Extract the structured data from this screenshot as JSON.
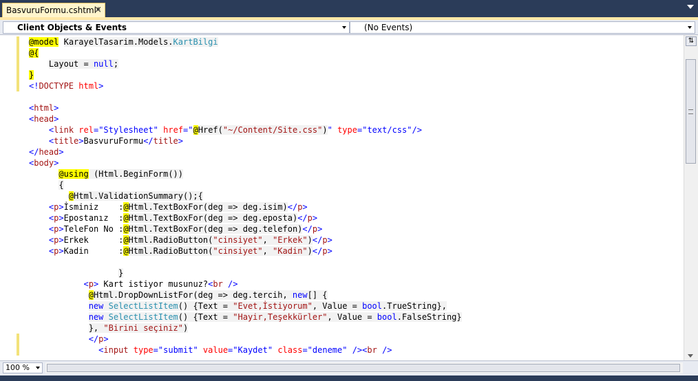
{
  "tab": {
    "title": "BasvuruFormu.cshtml*",
    "close": "×"
  },
  "nav": {
    "objects": "Client Objects & Events",
    "events": "(No Events)"
  },
  "zoom": "100 %",
  "code_lines": [
    [
      {
        "t": "@model",
        "c": "razor"
      },
      {
        "t": " "
      },
      {
        "t": "KarayelTasarim.Models.",
        "c": "strip"
      },
      {
        "t": "KartBilgi",
        "c": "k-type strip"
      }
    ],
    [
      {
        "t": "@{",
        "c": "razor"
      }
    ],
    [
      {
        "t": "    "
      },
      {
        "t": "Layout = ",
        "c": "strip"
      },
      {
        "t": "null",
        "c": "k-blue strip"
      },
      {
        "t": ";",
        "c": "strip"
      }
    ],
    [
      {
        "t": "}",
        "c": "razor"
      }
    ],
    [
      {
        "t": "<!",
        "c": "k-blue"
      },
      {
        "t": "DOCTYPE",
        "c": "k-maroon"
      },
      {
        "t": " "
      },
      {
        "t": "html",
        "c": "k-red"
      },
      {
        "t": ">",
        "c": "k-blue"
      }
    ],
    [
      {
        "t": ""
      }
    ],
    [
      {
        "t": "<",
        "c": "k-blue"
      },
      {
        "t": "html",
        "c": "k-maroon"
      },
      {
        "t": ">",
        "c": "k-blue"
      }
    ],
    [
      {
        "t": "<",
        "c": "k-blue"
      },
      {
        "t": "head",
        "c": "k-maroon"
      },
      {
        "t": ">",
        "c": "k-blue"
      }
    ],
    [
      {
        "t": "    "
      },
      {
        "t": "<",
        "c": "k-blue"
      },
      {
        "t": "link",
        "c": "k-maroon"
      },
      {
        "t": " "
      },
      {
        "t": "rel",
        "c": "k-red"
      },
      {
        "t": "=",
        "c": "k-blue"
      },
      {
        "t": "\"Stylesheet\"",
        "c": "k-blue"
      },
      {
        "t": " "
      },
      {
        "t": "href",
        "c": "k-red"
      },
      {
        "t": "=",
        "c": "k-blue"
      },
      {
        "t": "\"",
        "c": "k-blue"
      },
      {
        "t": "@",
        "c": "razor"
      },
      {
        "t": "Href(",
        "c": "strip"
      },
      {
        "t": "\"~/Content/Site.css\"",
        "c": "k-str strip"
      },
      {
        "t": ")",
        "c": "strip"
      },
      {
        "t": "\"",
        "c": "k-blue"
      },
      {
        "t": " "
      },
      {
        "t": "type",
        "c": "k-red"
      },
      {
        "t": "=",
        "c": "k-blue"
      },
      {
        "t": "\"text/css\"",
        "c": "k-blue"
      },
      {
        "t": "/>",
        "c": "k-blue"
      }
    ],
    [
      {
        "t": "    "
      },
      {
        "t": "<",
        "c": "k-blue"
      },
      {
        "t": "title",
        "c": "k-maroon"
      },
      {
        "t": ">",
        "c": "k-blue"
      },
      {
        "t": "BasvuruFormu"
      },
      {
        "t": "</",
        "c": "k-blue"
      },
      {
        "t": "title",
        "c": "k-maroon"
      },
      {
        "t": ">",
        "c": "k-blue"
      }
    ],
    [
      {
        "t": "</",
        "c": "k-blue"
      },
      {
        "t": "head",
        "c": "k-maroon"
      },
      {
        "t": ">",
        "c": "k-blue"
      }
    ],
    [
      {
        "t": "<",
        "c": "k-blue"
      },
      {
        "t": "body",
        "c": "k-maroon"
      },
      {
        "t": ">",
        "c": "k-blue"
      }
    ],
    [
      {
        "t": "      "
      },
      {
        "t": "@using",
        "c": "razor"
      },
      {
        "t": " (Html.BeginForm())",
        "c": "strip"
      }
    ],
    [
      {
        "t": "      "
      },
      {
        "t": "{",
        "c": "strip"
      }
    ],
    [
      {
        "t": "        "
      },
      {
        "t": "@",
        "c": "razor"
      },
      {
        "t": "Html.ValidationSummary();{",
        "c": "strip"
      }
    ],
    [
      {
        "t": "    "
      },
      {
        "t": "<",
        "c": "k-blue"
      },
      {
        "t": "p",
        "c": "k-maroon"
      },
      {
        "t": ">",
        "c": "k-blue"
      },
      {
        "t": "İsminiz    :"
      },
      {
        "t": "@",
        "c": "razor"
      },
      {
        "t": "Html.TextBoxFor(deg => deg.isim)",
        "c": "strip"
      },
      {
        "t": "</",
        "c": "k-blue"
      },
      {
        "t": "p",
        "c": "k-maroon"
      },
      {
        "t": ">",
        "c": "k-blue"
      }
    ],
    [
      {
        "t": "    "
      },
      {
        "t": "<",
        "c": "k-blue"
      },
      {
        "t": "p",
        "c": "k-maroon"
      },
      {
        "t": ">",
        "c": "k-blue"
      },
      {
        "t": "Epostanız  :"
      },
      {
        "t": "@",
        "c": "razor"
      },
      {
        "t": "Html.TextBoxFor(deg => deg.eposta)",
        "c": "strip"
      },
      {
        "t": "</",
        "c": "k-blue"
      },
      {
        "t": "p",
        "c": "k-maroon"
      },
      {
        "t": ">",
        "c": "k-blue"
      }
    ],
    [
      {
        "t": "    "
      },
      {
        "t": "<",
        "c": "k-blue"
      },
      {
        "t": "p",
        "c": "k-maroon"
      },
      {
        "t": ">",
        "c": "k-blue"
      },
      {
        "t": "TeleFon No :"
      },
      {
        "t": "@",
        "c": "razor"
      },
      {
        "t": "Html.TextBoxFor(deg => deg.telefon)",
        "c": "strip"
      },
      {
        "t": "</",
        "c": "k-blue"
      },
      {
        "t": "p",
        "c": "k-maroon"
      },
      {
        "t": ">",
        "c": "k-blue"
      }
    ],
    [
      {
        "t": "    "
      },
      {
        "t": "<",
        "c": "k-blue"
      },
      {
        "t": "p",
        "c": "k-maroon"
      },
      {
        "t": ">",
        "c": "k-blue"
      },
      {
        "t": "Erkek      :"
      },
      {
        "t": "@",
        "c": "razor"
      },
      {
        "t": "Html.RadioButton(",
        "c": "strip"
      },
      {
        "t": "\"cinsiyet\"",
        "c": "k-str strip"
      },
      {
        "t": ", ",
        "c": "strip"
      },
      {
        "t": "\"Erkek\"",
        "c": "k-str strip"
      },
      {
        "t": ")",
        "c": "strip"
      },
      {
        "t": "</",
        "c": "k-blue"
      },
      {
        "t": "p",
        "c": "k-maroon"
      },
      {
        "t": ">",
        "c": "k-blue"
      }
    ],
    [
      {
        "t": "    "
      },
      {
        "t": "<",
        "c": "k-blue"
      },
      {
        "t": "p",
        "c": "k-maroon"
      },
      {
        "t": ">",
        "c": "k-blue"
      },
      {
        "t": "Kadin      :"
      },
      {
        "t": "@",
        "c": "razor"
      },
      {
        "t": "Html.RadioButton(",
        "c": "strip"
      },
      {
        "t": "\"cinsiyet\"",
        "c": "k-str strip"
      },
      {
        "t": ", ",
        "c": "strip"
      },
      {
        "t": "\"Kadin\"",
        "c": "k-str strip"
      },
      {
        "t": ")",
        "c": "strip"
      },
      {
        "t": "</",
        "c": "k-blue"
      },
      {
        "t": "p",
        "c": "k-maroon"
      },
      {
        "t": ">",
        "c": "k-blue"
      }
    ],
    [
      {
        "t": ""
      }
    ],
    [
      {
        "t": "                  "
      },
      {
        "t": "}",
        "c": "strip"
      }
    ],
    [
      {
        "t": "           "
      },
      {
        "t": "<",
        "c": "k-blue"
      },
      {
        "t": "p",
        "c": "k-maroon"
      },
      {
        "t": ">",
        "c": "k-blue"
      },
      {
        "t": " Kart istiyor musunuz?"
      },
      {
        "t": "<",
        "c": "k-blue"
      },
      {
        "t": "br",
        "c": "k-maroon"
      },
      {
        "t": " />",
        "c": "k-blue"
      }
    ],
    [
      {
        "t": "            "
      },
      {
        "t": "@",
        "c": "razor"
      },
      {
        "t": "Html.DropDownListFor(deg => deg.tercih, ",
        "c": "strip"
      },
      {
        "t": "new",
        "c": "k-blue strip"
      },
      {
        "t": "[] {",
        "c": "strip"
      }
    ],
    [
      {
        "t": "            "
      },
      {
        "t": "new",
        "c": "k-blue strip"
      },
      {
        "t": " ",
        "c": "strip"
      },
      {
        "t": "SelectListItem",
        "c": "k-type strip"
      },
      {
        "t": "() {Text = ",
        "c": "strip"
      },
      {
        "t": "\"Evet,İstiyorum\"",
        "c": "k-str strip"
      },
      {
        "t": ", Value = ",
        "c": "strip"
      },
      {
        "t": "bool",
        "c": "k-blue strip"
      },
      {
        "t": ".TrueString},",
        "c": "strip"
      }
    ],
    [
      {
        "t": "            "
      },
      {
        "t": "new",
        "c": "k-blue strip"
      },
      {
        "t": " ",
        "c": "strip"
      },
      {
        "t": "SelectListItem",
        "c": "k-type strip"
      },
      {
        "t": "() {Text = ",
        "c": "strip"
      },
      {
        "t": "\"Hayir,Teşekkürler\"",
        "c": "k-str strip"
      },
      {
        "t": ", Value = ",
        "c": "strip"
      },
      {
        "t": "bool",
        "c": "k-blue strip"
      },
      {
        "t": ".FalseString}",
        "c": "strip"
      }
    ],
    [
      {
        "t": "            "
      },
      {
        "t": "}, ",
        "c": "strip"
      },
      {
        "t": "\"Birini seçiniz\"",
        "c": "k-str strip"
      },
      {
        "t": ")",
        "c": "strip"
      }
    ],
    [
      {
        "t": "            "
      },
      {
        "t": "</",
        "c": "k-blue"
      },
      {
        "t": "p",
        "c": "k-maroon"
      },
      {
        "t": ">",
        "c": "k-blue"
      }
    ],
    [
      {
        "t": "              "
      },
      {
        "t": "<",
        "c": "k-blue"
      },
      {
        "t": "input",
        "c": "k-maroon"
      },
      {
        "t": " "
      },
      {
        "t": "type",
        "c": "k-red"
      },
      {
        "t": "=",
        "c": "k-blue"
      },
      {
        "t": "\"submit\"",
        "c": "k-blue"
      },
      {
        "t": " "
      },
      {
        "t": "value",
        "c": "k-red"
      },
      {
        "t": "=",
        "c": "k-blue"
      },
      {
        "t": "\"Kaydet\"",
        "c": "k-blue"
      },
      {
        "t": " "
      },
      {
        "t": "class",
        "c": "k-red"
      },
      {
        "t": "=",
        "c": "k-blue"
      },
      {
        "t": "\"deneme\"",
        "c": "k-blue"
      },
      {
        "t": " />",
        "c": "k-blue"
      },
      {
        "t": "<",
        "c": "k-blue"
      },
      {
        "t": "br",
        "c": "k-maroon"
      },
      {
        "t": " />",
        "c": "k-blue"
      }
    ]
  ]
}
